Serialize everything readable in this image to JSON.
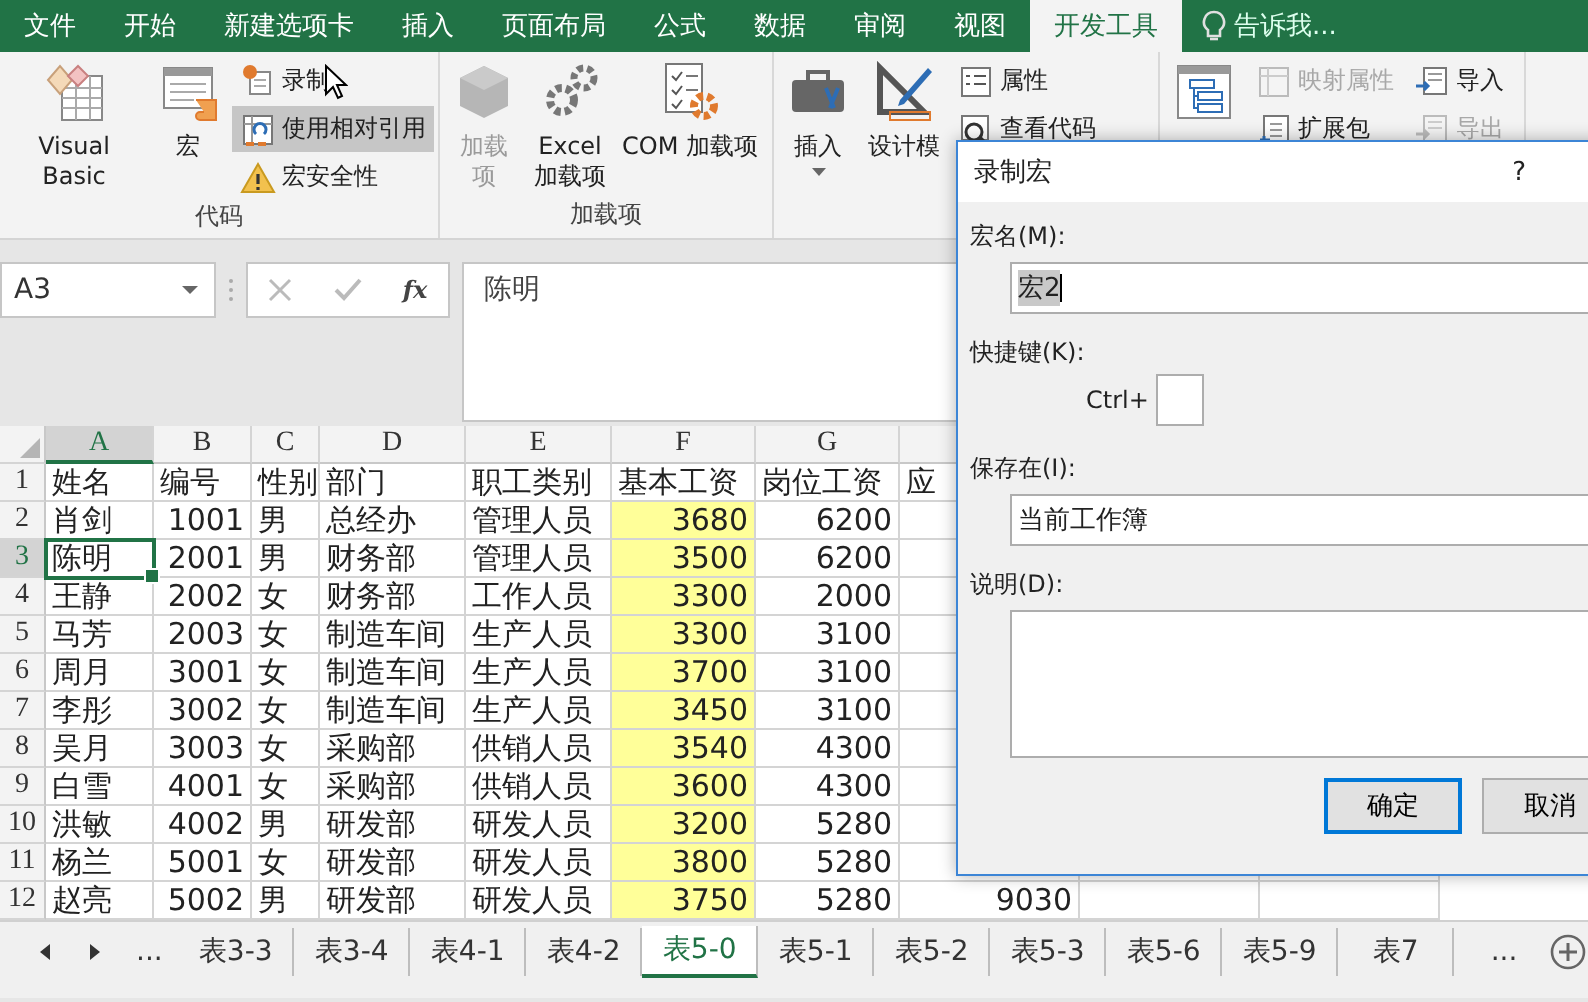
{
  "menu_tabs": [
    {
      "label": "文件",
      "selected": false
    },
    {
      "label": "开始",
      "selected": false
    },
    {
      "label": "新建选项卡",
      "selected": false
    },
    {
      "label": "插入",
      "selected": false
    },
    {
      "label": "页面布局",
      "selected": false
    },
    {
      "label": "公式",
      "selected": false
    },
    {
      "label": "数据",
      "selected": false
    },
    {
      "label": "审阅",
      "selected": false
    },
    {
      "label": "视图",
      "selected": false
    },
    {
      "label": "开发工具",
      "selected": true
    }
  ],
  "tell_me": {
    "placeholder": "告诉我..."
  },
  "ribbon": {
    "groups": [
      {
        "label": "代码",
        "items": [
          {
            "kind": "large",
            "label": "Visual Basic",
            "disabled": false
          },
          {
            "kind": "large",
            "label": "宏",
            "disabled": false
          },
          {
            "kind": "small_stack",
            "items": [
              {
                "label": "录制",
                "disabled": false,
                "selected": false
              },
              {
                "label": "使用相对引用",
                "disabled": false,
                "selected": true
              },
              {
                "label": "宏安全性",
                "disabled": false,
                "selected": false
              }
            ]
          }
        ]
      },
      {
        "label": "加载项",
        "items": [
          {
            "kind": "large",
            "label": "加载项",
            "disabled": true
          },
          {
            "kind": "large",
            "label": "Excel\n加载项",
            "disabled": false
          },
          {
            "kind": "large",
            "label": "COM 加载项",
            "disabled": false
          }
        ]
      },
      {
        "items": [
          {
            "kind": "large",
            "label": "插入",
            "disabled": false,
            "dropdown": true
          },
          {
            "kind": "large",
            "label": "设计模",
            "disabled": false
          },
          {
            "kind": "small_stack",
            "items": [
              {
                "label": "属性",
                "disabled": false,
                "selected": false
              },
              {
                "label": "查看代码",
                "disabled": false,
                "selected": false
              }
            ]
          }
        ]
      },
      {
        "items": [
          {
            "kind": "large",
            "disabled": false
          },
          {
            "kind": "small_stack",
            "items": [
              {
                "label": "映射属性",
                "disabled": true,
                "selected": false
              },
              {
                "label": "扩展包",
                "disabled": false,
                "selected": false
              }
            ]
          },
          {
            "kind": "small_stack",
            "items": [
              {
                "label": "导入",
                "disabled": false,
                "selected": false
              },
              {
                "label": "导出",
                "disabled": true,
                "selected": false
              }
            ]
          }
        ]
      }
    ]
  },
  "formula_bar": {
    "name_box": "A3",
    "function_button": "fx",
    "value": "陈明"
  },
  "sheet": {
    "columns": [
      {
        "letter": "A",
        "selected": true,
        "highlighted": false
      },
      {
        "letter": "B",
        "selected": false,
        "highlighted": false
      },
      {
        "letter": "C",
        "selected": false,
        "highlighted": false
      },
      {
        "letter": "D",
        "selected": false,
        "highlighted": false
      },
      {
        "letter": "E",
        "selected": false,
        "highlighted": false
      },
      {
        "letter": "F",
        "selected": false,
        "highlighted": true
      },
      {
        "letter": "G",
        "selected": false,
        "highlighted": false
      }
    ],
    "rows": [
      {
        "number": "1",
        "selected": false,
        "cells": [
          "姓名",
          "编号",
          "性别",
          "部门",
          "职工类别",
          "基本工资",
          "岗位工资",
          "应"
        ]
      },
      {
        "number": "2",
        "selected": false,
        "cells": [
          "肖剑",
          "1001",
          "男",
          "总经办",
          "管理人员",
          "3680",
          "6200"
        ]
      },
      {
        "number": "3",
        "selected": true,
        "cells": [
          "陈明",
          "2001",
          "男",
          "财务部",
          "管理人员",
          "3500",
          "6200"
        ]
      },
      {
        "number": "4",
        "selected": false,
        "cells": [
          "王静",
          "2002",
          "女",
          "财务部",
          "工作人员",
          "3300",
          "2000"
        ]
      },
      {
        "number": "5",
        "selected": false,
        "cells": [
          "马芳",
          "2003",
          "女",
          "制造车间",
          "生产人员",
          "3300",
          "3100"
        ]
      },
      {
        "number": "6",
        "selected": false,
        "cells": [
          "周月",
          "3001",
          "女",
          "制造车间",
          "生产人员",
          "3700",
          "3100"
        ]
      },
      {
        "number": "7",
        "selected": false,
        "cells": [
          "李彤",
          "3002",
          "女",
          "制造车间",
          "生产人员",
          "3450",
          "3100"
        ]
      },
      {
        "number": "8",
        "selected": false,
        "cells": [
          "吴月",
          "3003",
          "女",
          "采购部",
          "供销人员",
          "3540",
          "4300"
        ]
      },
      {
        "number": "9",
        "selected": false,
        "cells": [
          "白雪",
          "4001",
          "女",
          "采购部",
          "供销人员",
          "3600",
          "4300"
        ]
      },
      {
        "number": "10",
        "selected": false,
        "cells": [
          "洪敏",
          "4002",
          "男",
          "研发部",
          "研发人员",
          "3200",
          "5280"
        ]
      },
      {
        "number": "11",
        "selected": false,
        "cells": [
          "杨兰",
          "5001",
          "女",
          "研发部",
          "研发人员",
          "3800",
          "5280"
        ]
      },
      {
        "number": "12",
        "selected": false,
        "cells": [
          "赵亮",
          "5002",
          "男",
          "研发部",
          "研发人员",
          "3750",
          "5280",
          "9030"
        ]
      }
    ]
  },
  "sheet_tabs": {
    "more": "...",
    "tabs": [
      {
        "label": "表3-3",
        "selected": false
      },
      {
        "label": "表3-4",
        "selected": false
      },
      {
        "label": "表4-1",
        "selected": false
      },
      {
        "label": "表4-2",
        "selected": false
      },
      {
        "label": "表5-0",
        "selected": true
      },
      {
        "label": "表5-1",
        "selected": false
      },
      {
        "label": "表5-2",
        "selected": false
      },
      {
        "label": "表5-3",
        "selected": false
      },
      {
        "label": "表5-6",
        "selected": false
      },
      {
        "label": "表5-9",
        "selected": false
      },
      {
        "label": "表7",
        "selected": false
      }
    ],
    "more_after": "..."
  },
  "dialog": {
    "title": "录制宏",
    "help": "?",
    "fields": [
      {
        "kind": "text",
        "label": "宏名(M):",
        "value": "宏2",
        "value_selected": true
      },
      {
        "kind": "shortcut",
        "label": "快捷键(K):",
        "prefix": "Ctrl+"
      },
      {
        "kind": "text",
        "label": "保存在(I):",
        "value": "当前工作簿",
        "value_selected": false
      },
      {
        "kind": "textarea",
        "label": "说明(D):"
      }
    ],
    "buttons": [
      {
        "label": "确定",
        "default": true
      },
      {
        "label": "取消",
        "default": false
      }
    ]
  }
}
